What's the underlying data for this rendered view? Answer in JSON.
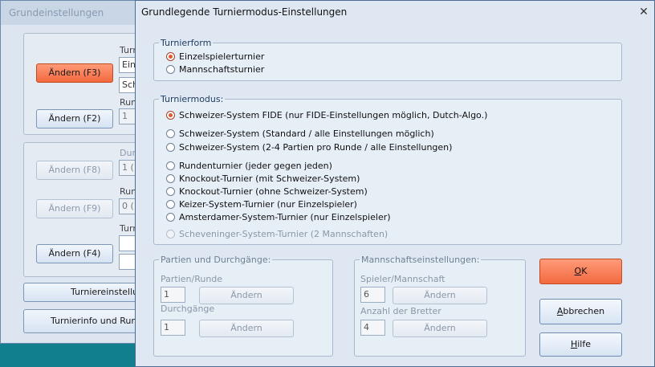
{
  "background_window": {
    "title": "Grundeinstellungen",
    "buttons": {
      "change_f3": "Ändern (F3)",
      "change_f2": "Ändern (F2)",
      "change_f8": "Ändern (F8)",
      "change_f9": "Ändern (F9)",
      "change_f4": "Ändern (F4)",
      "tournament_settings": "Turniereinstellu",
      "tournament_info": "Turnierinfo und Run"
    },
    "labels": {
      "turnier_1": "Turnie",
      "run_1": "Run",
      "dur": "Dur",
      "run_2": "Run",
      "turn": "Turn"
    },
    "fields": {
      "field_1": "Einz",
      "field_2": "Schw",
      "field_3": "1",
      "field_4": "1 (",
      "field_5": "0 ("
    }
  },
  "dialog": {
    "title": "Grundlegende Turniermodus-Einstellungen",
    "close_glyph": "✕",
    "turnierform": {
      "legend": "Turnierform",
      "options": [
        {
          "label": "Einzelspielerturnier",
          "checked": true
        },
        {
          "label": "Mannschaftsturnier",
          "checked": false
        }
      ]
    },
    "turniermodus": {
      "legend": "Turniermodus:",
      "options": [
        {
          "label": "Schweizer-System FIDE (nur FIDE-Einstellungen möglich, Dutch-Algo.)",
          "checked": true
        },
        {
          "label": "Schweizer-System (Standard / alle Einstellungen möglich)",
          "checked": false
        },
        {
          "label": "Schweizer-System (2-4 Partien pro Runde / alle Einstellungen)",
          "checked": false
        },
        {
          "label": "Rundenturnier (jeder gegen jeden)",
          "checked": false
        },
        {
          "label": "Knockout-Turnier (mit Schweizer-System)",
          "checked": false
        },
        {
          "label": "Knockout-Turnier (ohne Schweizer-System)",
          "checked": false
        },
        {
          "label": "Keizer-System-Turnier (nur Einzelspieler)",
          "checked": false
        },
        {
          "label": "Amsterdamer-System-Turnier (nur Einzelspieler)",
          "checked": false
        },
        {
          "label": "Scheveninger-System-Turnier (2 Mannschaften)",
          "checked": false,
          "disabled": true
        }
      ]
    },
    "partien": {
      "legend": "Partien und Durchgänge:",
      "games_per_round_label": "Partien/Runde",
      "games_per_round_value": "1",
      "rounds_label": "Durchgänge",
      "rounds_value": "1",
      "change_label": "Ändern"
    },
    "mannschaft": {
      "legend": "Mannschaftseinstellungen:",
      "players_label": "Spieler/Mannschaft",
      "players_value": "6",
      "boards_label": "Anzahl der Bretter",
      "boards_value": "4",
      "change_label": "Ändern"
    },
    "buttons": {
      "ok_hotkey": "O",
      "ok_rest": "K",
      "cancel_hotkey": "A",
      "cancel_rest": "bbrechen",
      "help_hotkey": "H",
      "help_rest": "ilfe"
    }
  },
  "colors": {
    "desktop": "#127f8f",
    "accent_orange": "#f36a40",
    "dialog_bg": "#dfe8f2"
  }
}
